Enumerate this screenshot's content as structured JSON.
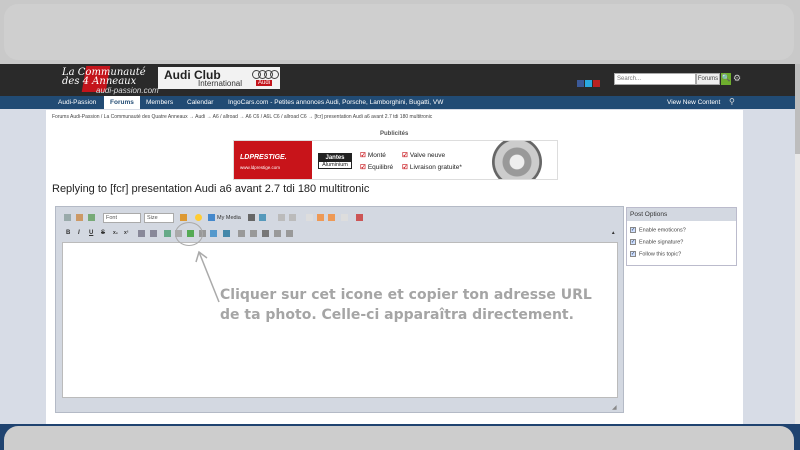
{
  "header": {
    "logo_line1": "La Communauté",
    "logo_line2": "des 4 Anneaux",
    "logo_sub": "audi-passion.com",
    "club_title": "Audi Club",
    "club_subtitle": "International",
    "club_brand": "Audi",
    "search_placeholder": "Search...",
    "search_scope": "Forums",
    "search_button": "🔍",
    "settings_icon": "⚙"
  },
  "nav": {
    "items": [
      {
        "label": "Audi-Passion",
        "active": false
      },
      {
        "label": "Forums",
        "active": true
      },
      {
        "label": "Members",
        "active": false
      },
      {
        "label": "Calendar",
        "active": false
      },
      {
        "label": "IngoCars.com - Petites annonces Audi, Porsche, Lamborghini, Bugatti, VW",
        "active": false
      }
    ],
    "view_new_content": "View New Content"
  },
  "breadcrumb": "Forums Audi-Passion / La Communauté des Quatre Anneaux  →  Audi  →  A6 / allroad  →  A6 C6 / A6L C6 / allroad C6  →  [fcr] presentation Audi a6 avant 2.7 tdi 180 multitronic",
  "ad": {
    "label": "Publicités",
    "brand": "LDPRESTIGE.",
    "url": "www.ldprestige.com",
    "jantes": "Jantes",
    "aluminium": "Aluminium",
    "checks": [
      "Monté",
      "Equilibré",
      "Valve neuve",
      "Livraison gratuite*"
    ]
  },
  "page_title": "Replying to [fcr] presentation Audi a6 avant 2.7 tdi 180 multitronic",
  "editor": {
    "font_select": "Font",
    "size_select": "Size",
    "my_media": "My Media"
  },
  "annotation": "Cliquer sur cet icone et copier ton adresse URL de ta photo. Celle-ci apparaîtra directement.",
  "post_options": {
    "title": "Post Options",
    "options": [
      {
        "prefix": "Enable",
        "rest": " emoticons?",
        "checked": true
      },
      {
        "prefix": "Enable",
        "rest": " signature?",
        "checked": true
      },
      {
        "prefix": "Follow",
        "rest": " this topic?",
        "checked": true
      }
    ]
  },
  "colors": {
    "header_bg": "#2a2a2a",
    "nav_bg": "#214b74",
    "accent_red": "#c4141b",
    "search_green": "#6eae2e"
  }
}
